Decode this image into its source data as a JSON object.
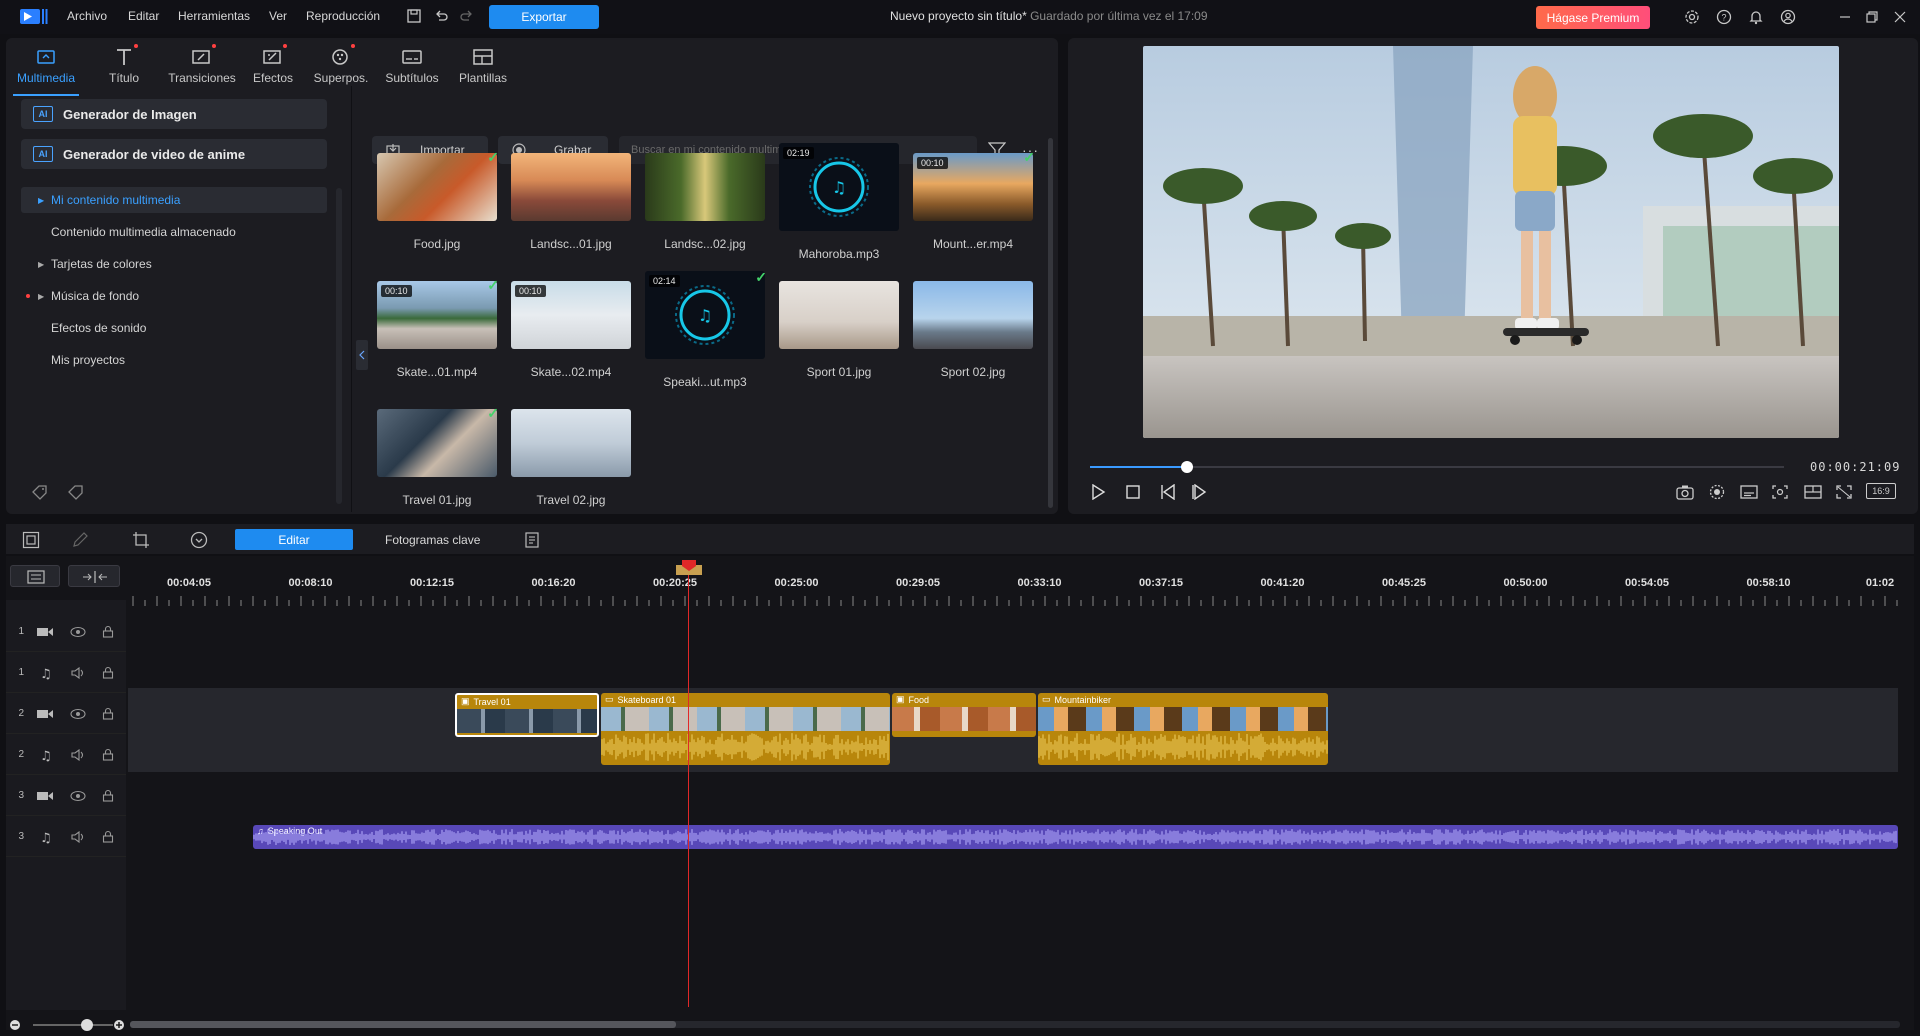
{
  "titlebar": {
    "menu": [
      "Archivo",
      "Editar",
      "Herramientas",
      "Ver",
      "Reproducción"
    ],
    "export_label": "Exportar",
    "project_title": "Nuevo proyecto sin título*",
    "saved_text": "Guardado por última vez el 17:09",
    "premium_label": "Hágase Premium"
  },
  "tool_tabs": [
    "Multimedia",
    "Título",
    "Transiciones",
    "Efectos",
    "Superpos.",
    "Subtítulos",
    "Plantillas"
  ],
  "ai_buttons": [
    "Generador de Imagen",
    "Generador de video de anime"
  ],
  "tree": [
    "Mi contenido multimedia",
    "Contenido multimedia almacenado",
    "Tarjetas de colores",
    "Música de fondo",
    "Efectos de sonido",
    "Mis proyectos"
  ],
  "library": {
    "import_label": "Importar",
    "record_label": "Grabar",
    "search_placeholder": "Buscar en mi contenido multimedia",
    "items": [
      {
        "name": "Food.jpg",
        "duration": ""
      },
      {
        "name": "Landsc...01.jpg",
        "duration": ""
      },
      {
        "name": "Landsc...02.jpg",
        "duration": ""
      },
      {
        "name": "Mahoroba.mp3",
        "duration": "02:19"
      },
      {
        "name": "Mount...er.mp4",
        "duration": "00:10"
      },
      {
        "name": "Skate...01.mp4",
        "duration": "00:10"
      },
      {
        "name": "Skate...02.mp4",
        "duration": "00:10"
      },
      {
        "name": "Speaki...ut.mp3",
        "duration": "02:14"
      },
      {
        "name": "Sport 01.jpg",
        "duration": ""
      },
      {
        "name": "Sport 02.jpg",
        "duration": ""
      },
      {
        "name": "Travel 01.jpg",
        "duration": ""
      },
      {
        "name": "Travel 02.jpg",
        "duration": ""
      }
    ]
  },
  "preview": {
    "timecode": "00:00:21:09",
    "progress": 0.14,
    "aspect_label": "16:9"
  },
  "timeline": {
    "edit_label": "Editar",
    "keyframes_label": "Fotogramas clave",
    "ruler": [
      "00:04:05",
      "00:08:10",
      "00:12:15",
      "00:16:20",
      "00:20:25",
      "00:25:00",
      "00:29:05",
      "00:33:10",
      "00:37:15",
      "00:41:20",
      "00:45:25",
      "00:50:00",
      "00:54:05",
      "00:58:10",
      "01:02"
    ],
    "tracks": [
      "1",
      "1",
      "2",
      "2",
      "3",
      "3"
    ],
    "clips": {
      "travel": "Travel 01",
      "skate": "Skateboard 01",
      "food": "Food",
      "mountain": "Mountainbiker",
      "audio": "Speaking Out"
    }
  },
  "colors": {
    "accent": "#1e8bf0",
    "premium": "#ff5a6a",
    "clip_gold": "#b8860b",
    "audio_purple": "#6a5acd",
    "playhead": "#e02828"
  }
}
